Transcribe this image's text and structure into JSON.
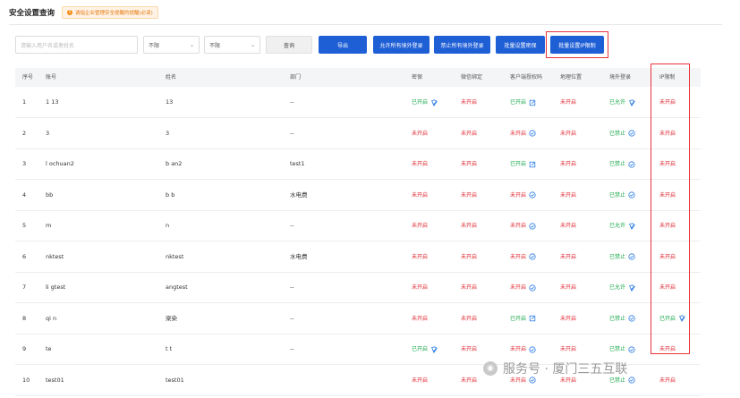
{
  "page": {
    "title": "安全设置查询",
    "tip": "请指企业管理安全提醒的提醒(必读)"
  },
  "toolbar": {
    "search_placeholder": "请输入用户名或者姓名",
    "filter1": "不限",
    "filter2": "不限",
    "query": "查询",
    "export": "导出",
    "allow_all": "允许所有境外登录",
    "forbid_all": "禁止所有境外登录",
    "batch_pwd": "批量设置密保",
    "batch_ip": "批量设置IP限制"
  },
  "columns": [
    "序号",
    "账号",
    "姓名",
    "部门",
    "密保",
    "微信绑定",
    "客户端授权码",
    "地理位置",
    "境外登录",
    "IP限制"
  ],
  "colors": {
    "primary": "#1f5fd6",
    "red": "#e0262e",
    "green": "#1aa84b",
    "highlight": "#e8333a"
  },
  "rows": [
    {
      "no": "1",
      "account": "1 13",
      "name": "13",
      "dept": "--",
      "mibao": "已开启",
      "mibao_icon": "shield-check",
      "wechat": "未开启",
      "client": "已开启",
      "client_icon": "edit",
      "geo": "未开启",
      "overseas": "已允许",
      "overseas_icon": "shield-check",
      "ip": "未开启"
    },
    {
      "no": "2",
      "account": "3",
      "name": "3",
      "dept": "--",
      "mibao": "未开启",
      "mibao_icon": "",
      "wechat": "未开启",
      "client": "未开启",
      "client_icon": "check-circle",
      "geo": "未开启",
      "overseas": "已禁止",
      "overseas_icon": "check-circle",
      "ip": "未开启"
    },
    {
      "no": "3",
      "account": "l ochuan2",
      "name": "b an2",
      "dept": "test1",
      "mibao": "未开启",
      "mibao_icon": "",
      "wechat": "未开启",
      "client": "已开启",
      "client_icon": "edit",
      "geo": "未开启",
      "overseas": "已禁止",
      "overseas_icon": "check-circle",
      "ip": "未开启"
    },
    {
      "no": "4",
      "account": "bb",
      "name": "b b",
      "dept": "水电费",
      "mibao": "未开启",
      "mibao_icon": "",
      "wechat": "未开启",
      "client": "未开启",
      "client_icon": "check-circle",
      "geo": "未开启",
      "overseas": "已禁止",
      "overseas_icon": "check-circle",
      "ip": "未开启"
    },
    {
      "no": "5",
      "account": "m",
      "name": "n",
      "dept": "--",
      "mibao": "未开启",
      "mibao_icon": "",
      "wechat": "未开启",
      "client": "未开启",
      "client_icon": "check-circle",
      "geo": "未开启",
      "overseas": "已允许",
      "overseas_icon": "shield-check",
      "ip": "未开启"
    },
    {
      "no": "6",
      "account": "nktest",
      "name": "nktest",
      "dept": "水电费",
      "mibao": "未开启",
      "mibao_icon": "",
      "wechat": "未开启",
      "client": "未开启",
      "client_icon": "check-circle",
      "geo": "未开启",
      "overseas": "已禁止",
      "overseas_icon": "check-circle",
      "ip": "未开启"
    },
    {
      "no": "7",
      "account": "li gtest",
      "name": "angtest",
      "dept": "--",
      "mibao": "未开启",
      "mibao_icon": "",
      "wechat": "未开启",
      "client": "未开启",
      "client_icon": "check-circle",
      "geo": "未开启",
      "overseas": "已允许",
      "overseas_icon": "shield-check",
      "ip": "未开启"
    },
    {
      "no": "8",
      "account": "qi n",
      "name": "梁染",
      "dept": "--",
      "mibao": "未开启",
      "mibao_icon": "",
      "wechat": "未开启",
      "client": "已开启",
      "client_icon": "edit",
      "geo": "未开启",
      "overseas": "已禁止",
      "overseas_icon": "check-circle",
      "ip": "已开启",
      "ip_icon": "shield-check"
    },
    {
      "no": "9",
      "account": "te",
      "name": "t t",
      "dept": "--",
      "mibao": "已开启",
      "mibao_icon": "shield-check",
      "wechat": "未开启",
      "client": "未开启",
      "client_icon": "check-circle",
      "geo": "未开启",
      "overseas": "已禁止",
      "overseas_icon": "check-circle",
      "ip": "未开启"
    },
    {
      "no": "10",
      "account": "test01",
      "name": "test01",
      "dept": "",
      "mibao": "未开启",
      "mibao_icon": "",
      "wechat": "未开启",
      "client": "未开启",
      "client_icon": "check-circle",
      "geo": "未开启",
      "overseas": "已禁止",
      "overseas_icon": "check-circle",
      "ip": "未开启"
    }
  ],
  "watermark": "服务号 · 厦门三五互联"
}
